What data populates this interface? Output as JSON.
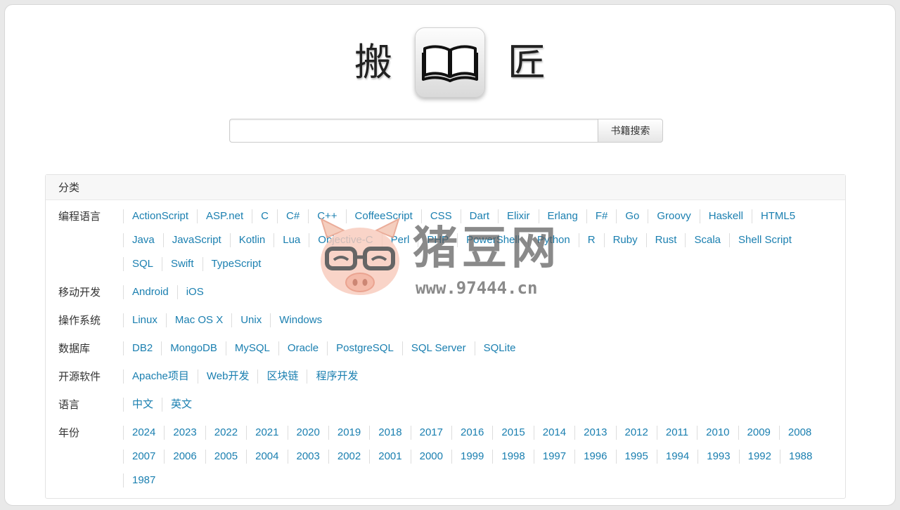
{
  "logo": {
    "left_char": "搬",
    "right_char": "匠",
    "icon": "book-icon"
  },
  "search": {
    "placeholder": "",
    "value": "",
    "button_label": "书籍搜索"
  },
  "panel": {
    "title": "分类",
    "rows": [
      {
        "label": "编程语言",
        "items": [
          "ActionScript",
          "ASP.net",
          "C",
          "C#",
          "C++",
          "CoffeeScript",
          "CSS",
          "Dart",
          "Elixir",
          "Erlang",
          "F#",
          "Go",
          "Groovy",
          "Haskell",
          "HTML5",
          "Java",
          "JavaScript",
          "Kotlin",
          "Lua",
          "Objective-C",
          "Perl",
          "PHP",
          "PowerShell",
          "Python",
          "R",
          "Ruby",
          "Rust",
          "Scala",
          "Shell Script",
          "SQL",
          "Swift",
          "TypeScript"
        ]
      },
      {
        "label": "移动开发",
        "items": [
          "Android",
          "iOS"
        ]
      },
      {
        "label": "操作系统",
        "items": [
          "Linux",
          "Mac OS X",
          "Unix",
          "Windows"
        ]
      },
      {
        "label": "数据库",
        "items": [
          "DB2",
          "MongoDB",
          "MySQL",
          "Oracle",
          "PostgreSQL",
          "SQL Server",
          "SQLite"
        ]
      },
      {
        "label": "开源软件",
        "items": [
          "Apache项目",
          "Web开发",
          "区块链",
          "程序开发"
        ]
      },
      {
        "label": "语言",
        "items": [
          "中文",
          "英文"
        ]
      },
      {
        "label": "年份",
        "items": [
          "2024",
          "2023",
          "2022",
          "2021",
          "2020",
          "2019",
          "2018",
          "2017",
          "2016",
          "2015",
          "2014",
          "2013",
          "2012",
          "2011",
          "2010",
          "2009",
          "2008",
          "2007",
          "2006",
          "2005",
          "2004",
          "2003",
          "2002",
          "2001",
          "2000",
          "1999",
          "1998",
          "1997",
          "1996",
          "1995",
          "1994",
          "1993",
          "1992",
          "1988",
          "1987"
        ]
      }
    ]
  },
  "watermark": {
    "text": "猪豆网",
    "url": "www.97444.cn",
    "icon": "pig-mascot-icon"
  }
}
